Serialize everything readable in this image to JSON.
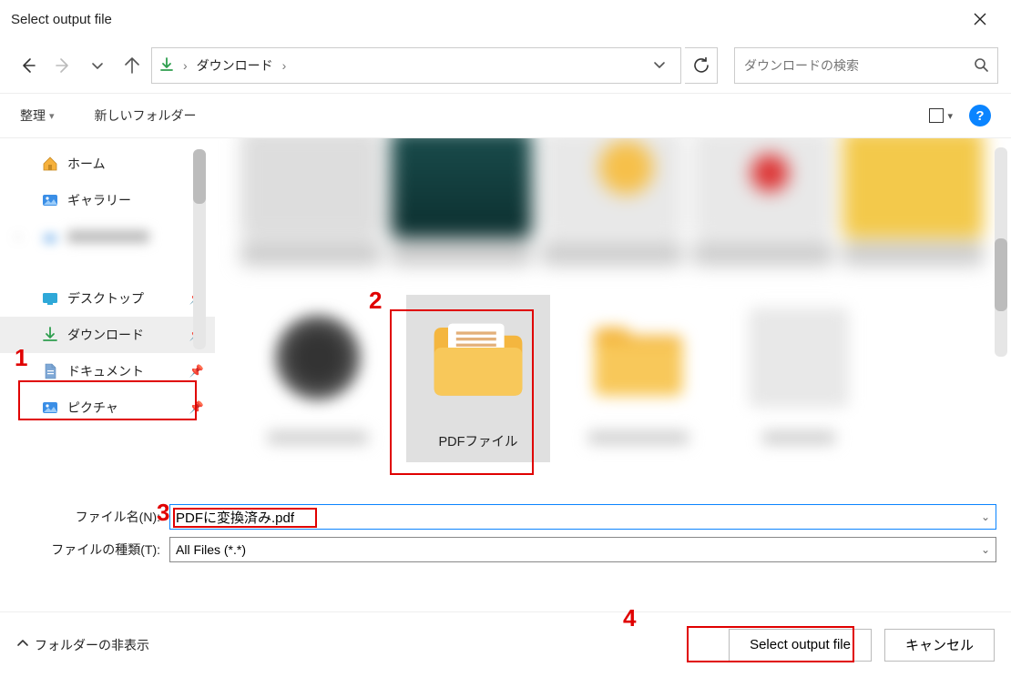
{
  "window": {
    "title": "Select output file"
  },
  "path": {
    "location": "ダウンロード"
  },
  "search": {
    "placeholder": "ダウンロードの検索"
  },
  "toolbar": {
    "organize": "整理",
    "new_folder": "新しいフォルダー"
  },
  "sidebar": {
    "home": "ホーム",
    "gallery": "ギャラリー",
    "desktop": "デスクトップ",
    "downloads": "ダウンロード",
    "documents": "ドキュメント",
    "pictures": "ピクチャ"
  },
  "content": {
    "selected_folder_label": "PDFファイル"
  },
  "fields": {
    "filename_label": "ファイル名(N):",
    "filename_value": "PDFに変換済み.pdf",
    "filetype_label": "ファイルの種類(T):",
    "filetype_value": "All Files (*.*)"
  },
  "footer": {
    "hide_folders": "フォルダーの非表示",
    "primary": "Select output file",
    "cancel": "キャンセル"
  },
  "annotations": {
    "n1": "1",
    "n2": "2",
    "n3": "3",
    "n4": "4"
  }
}
